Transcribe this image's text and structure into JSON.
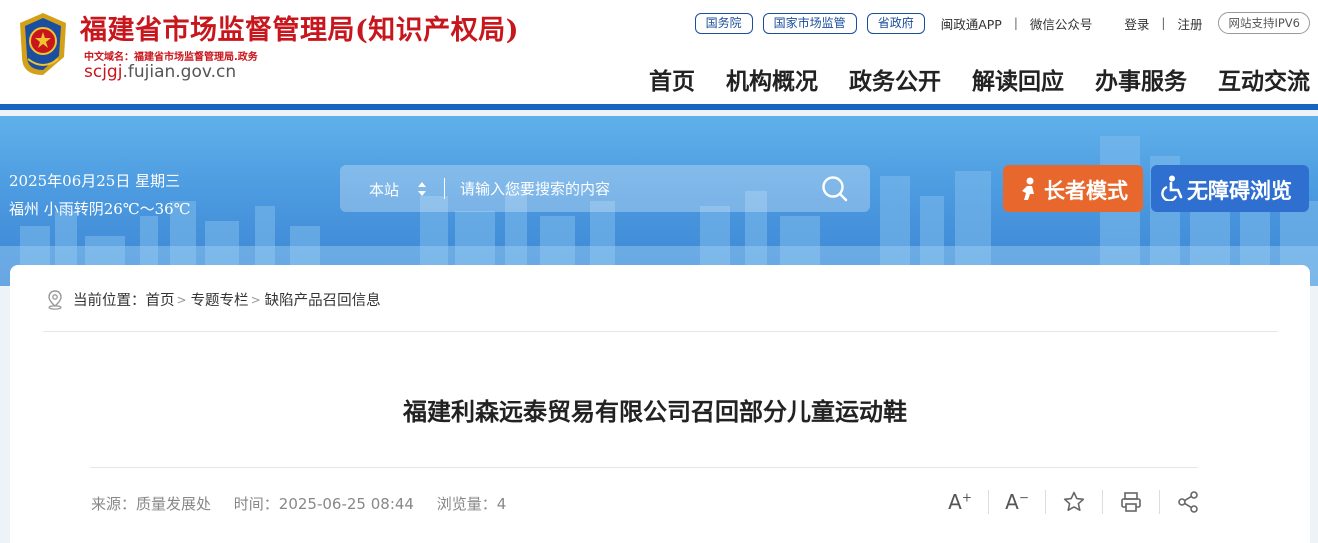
{
  "header": {
    "title": "福建省市场监督管理局(知识产权局)",
    "domain_cn": "中文域名：福建省市场监督管理局.政务",
    "domain_en_highlight": "scjgj",
    "domain_en_rest": ".fujian.gov.cn",
    "top_links": {
      "state_council": "国务院",
      "samr": "国家市场监管",
      "prov_gov": "省政府",
      "app": "闽政通APP",
      "sep": "|",
      "wechat": "微信公众号",
      "login": "登录",
      "register": "注册",
      "ipv6": "网站支持IPV6"
    },
    "nav": [
      "首页",
      "机构概况",
      "政务公开",
      "解读回应",
      "办事服务",
      "互动交流"
    ]
  },
  "banner": {
    "date": "2025年06月25日 星期三",
    "weather": "福州 小雨转阴26℃～36℃",
    "search": {
      "scope": "本站",
      "placeholder": "请输入您要搜索的内容"
    },
    "elder_mode": "长者模式",
    "accessibility": "无障碍浏览"
  },
  "breadcrumb": {
    "prefix": "当前位置：",
    "items": [
      "首页",
      "专题专栏",
      "缺陷产品召回信息"
    ],
    "gt": ">"
  },
  "article": {
    "title": "福建利森远泰贸易有限公司召回部分儿童运动鞋",
    "source": "来源：质量发展处",
    "time": "时间：2025-06-25 08:44",
    "views": "浏览量：4",
    "font_increase": "A",
    "font_decrease": "A"
  },
  "colors": {
    "brand_red": "#c8161d",
    "brand_blue": "#1565c0",
    "elder_orange": "#e8672c",
    "access_blue": "#2f6fd0"
  },
  "icons": [
    "national-emblem-icon",
    "sort-arrows-icon",
    "search-icon",
    "elder-icon",
    "wheelchair-icon",
    "location-pin-icon",
    "font-increase-icon",
    "font-decrease-icon",
    "star-icon",
    "print-icon",
    "share-icon"
  ]
}
